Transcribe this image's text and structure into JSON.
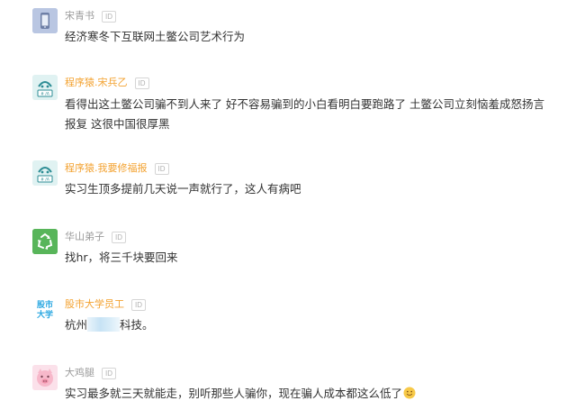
{
  "comments": [
    {
      "username": "宋青书",
      "badge": "ID",
      "text": "经济寒冬下互联网土鳖公司艺术行为",
      "avatar_icon": "phone-icon"
    },
    {
      "username": "程序猿.宋兵乙",
      "badge": "ID",
      "text_line1": "看得出这土鳖公司骗不到人来了 好不容易骗到的小白看明白要跑路了 土鳖公司立刻恼羞成怒扬言",
      "text_line2": "报复 这很中国很厚黑",
      "avatar_icon": "programmer-ape-icon",
      "avatar_label": "# /A"
    },
    {
      "username": "程序猿.我要修福报",
      "badge": "ID",
      "text": "实习生顶多提前几天说一声就行了，这人有病吧",
      "avatar_icon": "programmer-ape-icon",
      "avatar_label": "# /A"
    },
    {
      "username": "华山弟子",
      "badge": "ID",
      "text": "找hr，将三千块要回来",
      "avatar_icon": "recycle-icon"
    },
    {
      "username": "股市大学员工",
      "badge": "ID",
      "text_before": "杭州",
      "text_after": "科技。",
      "avatar_icon": "stock-university-logo",
      "avatar_label": "股市大学"
    },
    {
      "username": "大鸡腿",
      "badge": "ID",
      "text": "实习最多就三天就能走，别听那些人骗你，现在骗人成本都这么低了",
      "avatar_icon": "pig-face-icon"
    }
  ],
  "colors": {
    "username": "#9a9a9a",
    "vip_username": "#f3a230",
    "text": "#333333"
  }
}
